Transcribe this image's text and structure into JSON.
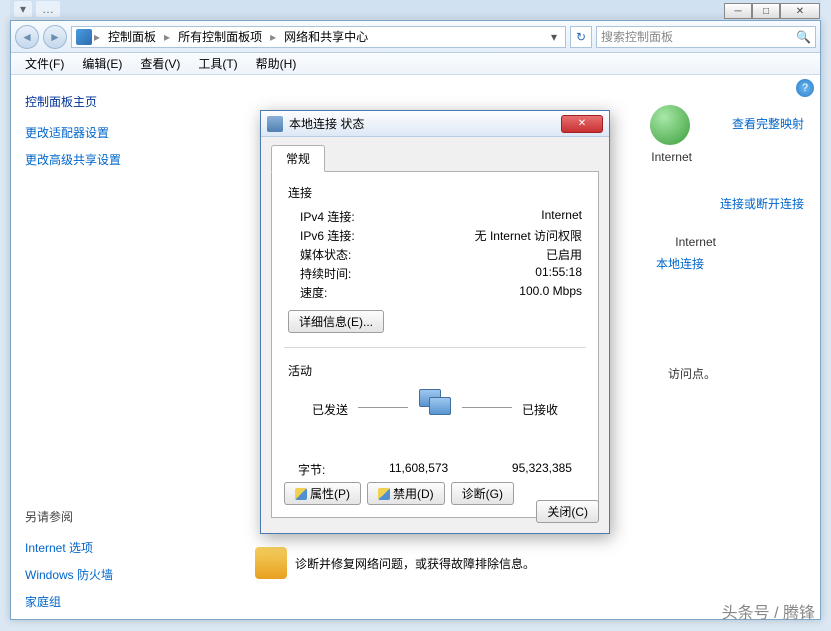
{
  "breadcrumbs": [
    "控制面板",
    "所有控制面板项",
    "网络和共享中心"
  ],
  "search": {
    "placeholder": "搜索控制面板"
  },
  "menu": [
    "文件(F)",
    "编辑(E)",
    "查看(V)",
    "工具(T)",
    "帮助(H)"
  ],
  "sidebar": {
    "heading": "控制面板主页",
    "links": [
      "更改适配器设置",
      "更改高级共享设置"
    ],
    "seealso_heading": "另请参阅",
    "seealso": [
      "Internet 选项",
      "Windows 防火墙",
      "家庭组"
    ]
  },
  "main": {
    "internet_label": "Internet",
    "view_full_map": "查看完整映射",
    "connect_or_disconnect": "连接或断开连接",
    "access_type_label": "Internet",
    "local_connection": "本地连接",
    "no_access_point": "访问点。",
    "troubleshoot": "诊断并修复网络问题，或获得故障排除信息。"
  },
  "dialog": {
    "title": "本地连接 状态",
    "tab": "常规",
    "conn_heading": "连接",
    "rows": {
      "ipv4_label": "IPv4 连接:",
      "ipv4_value": "Internet",
      "ipv6_label": "IPv6 连接:",
      "ipv6_value": "无 Internet 访问权限",
      "media_label": "媒体状态:",
      "media_value": "已启用",
      "duration_label": "持续时间:",
      "duration_value": "01:55:18",
      "speed_label": "速度:",
      "speed_value": "100.0 Mbps"
    },
    "details_btn": "详细信息(E)...",
    "activity_heading": "活动",
    "sent_label": "已发送",
    "recv_label": "已接收",
    "bytes_label": "字节:",
    "bytes_sent": "11,608,573",
    "bytes_recv": "95,323,385",
    "props_btn": "属性(P)",
    "disable_btn": "禁用(D)",
    "diag_btn": "诊断(G)",
    "close_btn": "关闭(C)"
  },
  "watermark": "头条号 / 腾锋"
}
